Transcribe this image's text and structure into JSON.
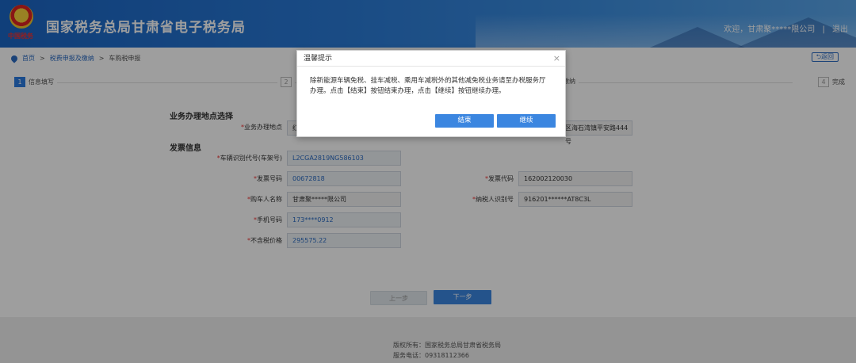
{
  "header": {
    "site_title": "国家税务总局甘肃省电子税务局",
    "emblem_caption": "中国税务",
    "welcome": "欢迎，甘肃聚*****限公司",
    "separator": "|",
    "logout": "退出"
  },
  "breadcrumb": {
    "home": "首页",
    "sep1": ">",
    "level2": "税费申报及缴纳",
    "sep2": ">",
    "level3": "车购税申报",
    "back": "返回"
  },
  "steps": [
    {
      "num": "1",
      "label": "信息填写"
    },
    {
      "num": "2",
      "label": ""
    },
    {
      "num": "3",
      "label": "税款缴纳"
    },
    {
      "num": "4",
      "label": "完成"
    }
  ],
  "form": {
    "section_location": "业务办理地点选择",
    "location_label": "业务办理地点",
    "location_value_left": "红",
    "location_value_right": "区海石湾镇平安路444号",
    "section_invoice": "发票信息",
    "vin_label": "车辆识别代号(车架号)",
    "vin_value": "L2CGA2819NG586103",
    "invoice_no_label": "发票号码",
    "invoice_no_value": "00672818",
    "invoice_code_label": "发票代码",
    "invoice_code_value": "162002120030",
    "buyer_label": "购车人名称",
    "buyer_value": "甘肃聚*****限公司",
    "taxpayer_id_label": "纳税人识别号",
    "taxpayer_id_value": "916201******AT8C3L",
    "phone_label": "手机号码",
    "phone_value": "173****0912",
    "price_label": "不含税价格",
    "price_value": "295575.22",
    "required_mark": "*"
  },
  "actions": {
    "prev": "上一步",
    "next": "下一步"
  },
  "dialog": {
    "title": "温馨提示",
    "close": "×",
    "body": "除新能源车辆免税、挂车减税、乘用车减税外的其他减免税业务请至办税服务厅办理。点击【结束】按钮结束办理，点击【继续】按钮继续办理。",
    "end_button": "结束",
    "continue_button": "继续"
  },
  "footer": {
    "copyright": "版权所有：国家税务总局甘肃省税务局",
    "phone": "服务电话：09318112366"
  },
  "colors": {
    "primary": "#3b86e0",
    "header_start": "#1b66c5",
    "required": "#e33333"
  }
}
